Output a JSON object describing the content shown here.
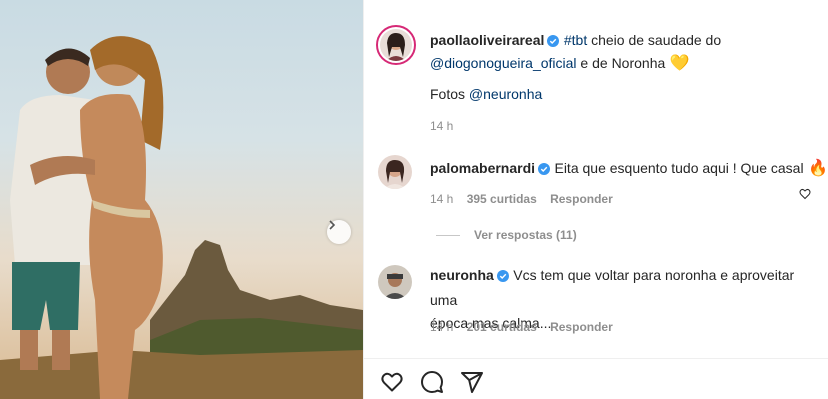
{
  "post": {
    "username": "paollaoliveirareal",
    "caption_prefix": "#tbt",
    "caption_text": " cheio de saudade do",
    "mention": "@diogonogueira_oficial",
    "caption_suffix": " e de Noronha",
    "heart_emoji": "💛",
    "credits_label": "Fotos ",
    "credits_mention": "@neuronha",
    "time": "14 h"
  },
  "comments": [
    {
      "username": "palomabernardi",
      "text": "Eita que esquento tudo aqui ! Que casal",
      "emoji": "🔥",
      "time": "14 h",
      "likes": "395 curtidas",
      "reply": "Responder",
      "view_replies": "Ver respostas (11)"
    },
    {
      "username": "neuronha",
      "text_line1": "Vcs tem que voltar para noronha e aproveitar uma",
      "text_line2": "época mas calma...",
      "time": "14 h",
      "likes": "201 curtidas",
      "reply": "Responder"
    }
  ],
  "actions": [
    "like-icon",
    "comment-icon",
    "share-icon"
  ],
  "colors": {
    "verified": "#3897f0",
    "link": "#00376b",
    "meta": "#8e8e8e",
    "story_ring": "#d62976"
  }
}
